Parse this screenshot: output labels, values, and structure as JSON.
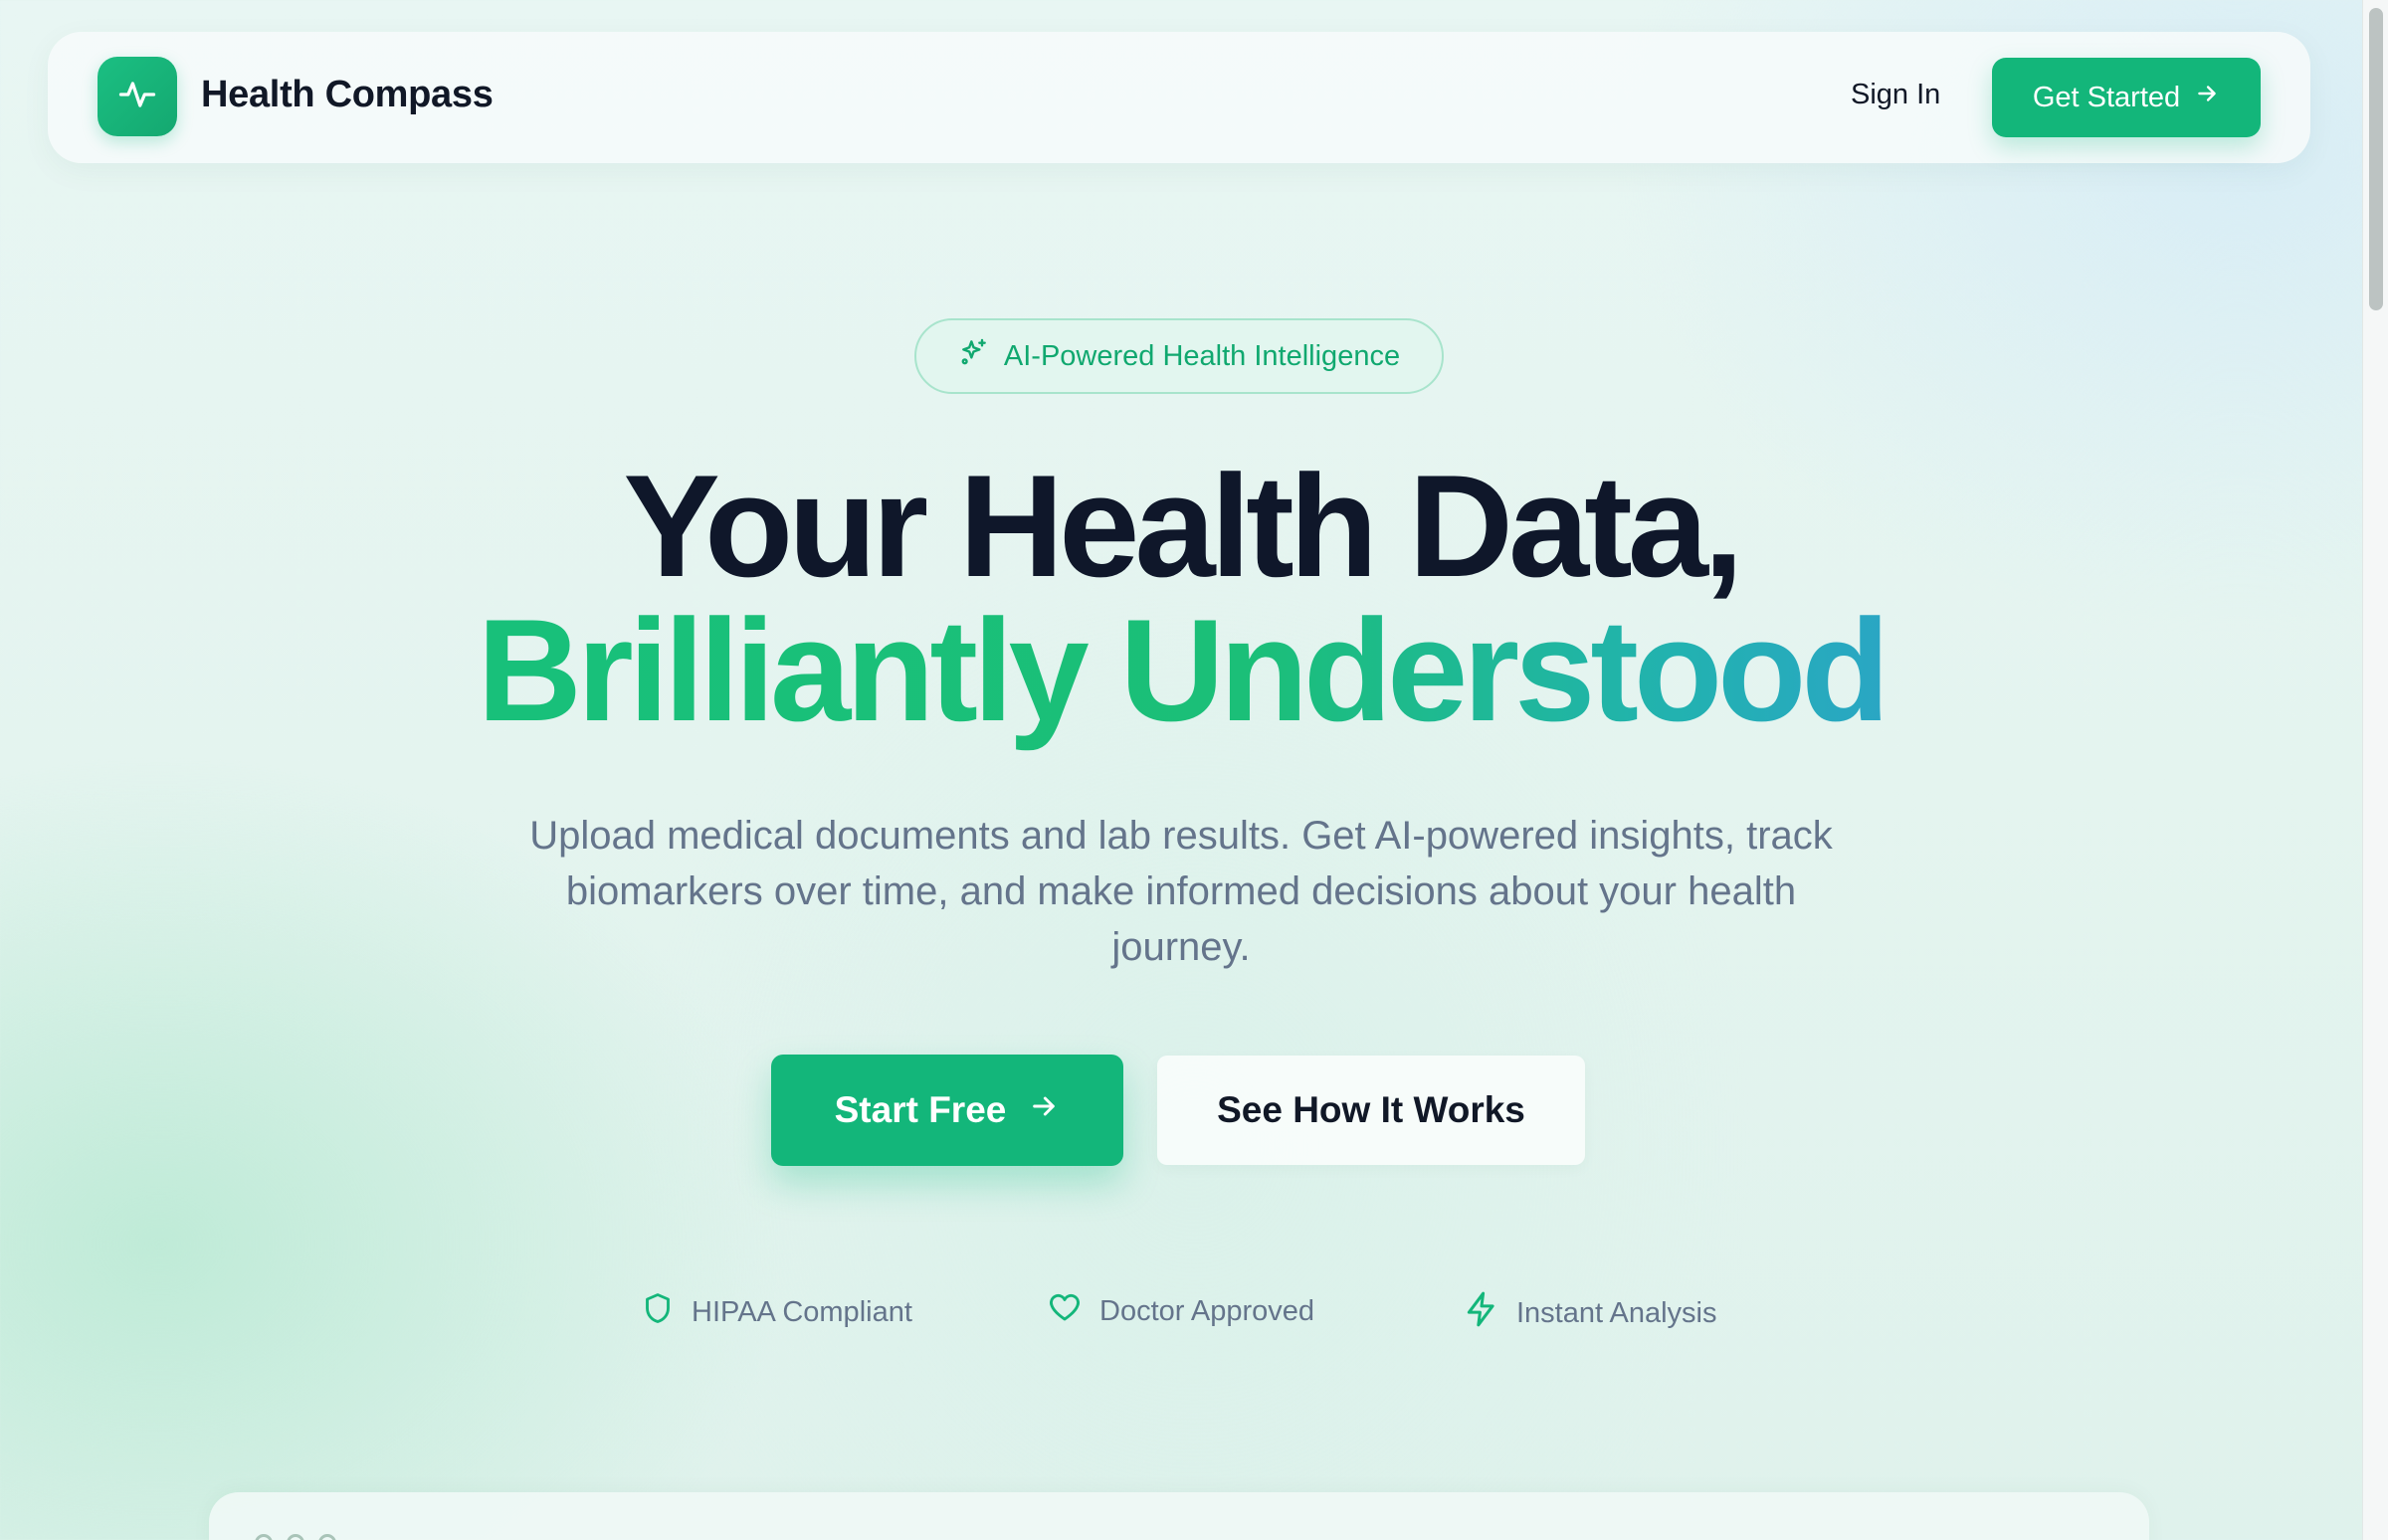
{
  "header": {
    "brand": "Health Compass",
    "logo_icon": "activity-pulse-icon",
    "sign_in": "Sign In",
    "get_started": "Get Started"
  },
  "hero": {
    "badge": "AI-Powered Health Intelligence",
    "badge_icon": "sparkles-icon",
    "headline_line1": "Your Health Data,",
    "headline_line2": "Brilliantly Understood",
    "subtext": "Upload medical documents and lab results. Get AI-powered insights, track biomarkers over time, and make informed decisions about your health journey.",
    "primary_cta": "Start Free",
    "secondary_cta": "See How It Works"
  },
  "trust_badges": [
    {
      "icon": "shield-icon",
      "label": "HIPAA Compliant"
    },
    {
      "icon": "heart-icon",
      "label": "Doctor Approved"
    },
    {
      "icon": "lightning-icon",
      "label": "Instant Analysis"
    }
  ],
  "colors": {
    "accent": "#13b67a",
    "heading": "#0f172a",
    "muted_text": "#64748b",
    "gradient_end": "#2aa6c4"
  }
}
